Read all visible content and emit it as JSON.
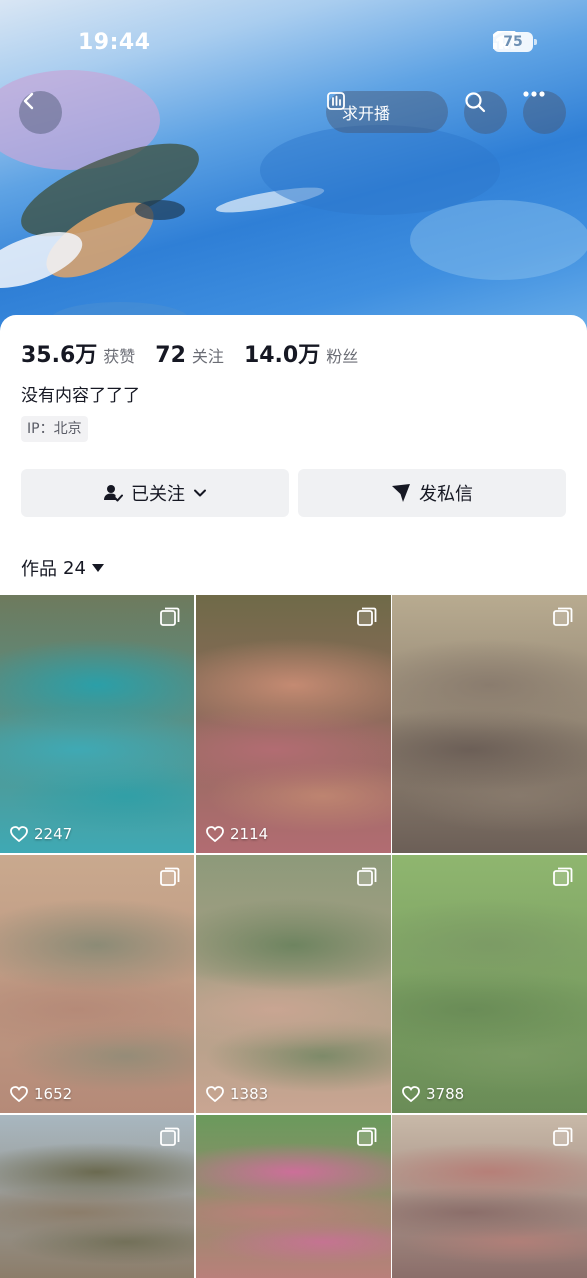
{
  "status_bar": {
    "time": "19:44",
    "battery": "75"
  },
  "header": {
    "back_icon": "chevron-left-icon",
    "live_request_label": "求开播",
    "search_icon": "search-icon",
    "more_icon": "more-icon"
  },
  "profile": {
    "stats": [
      {
        "value": "35.6万",
        "label": "获赞"
      },
      {
        "value": "72",
        "label": "关注"
      },
      {
        "value": "14.0万",
        "label": "粉丝"
      }
    ],
    "bio": "没有内容了了了",
    "ip": "IP：北京"
  },
  "actions": {
    "followed_label": "已关注",
    "message_label": "发私信"
  },
  "works": {
    "label": "作品",
    "count": "24"
  },
  "grid": [
    {
      "likes": "2247",
      "colors": [
        "#6e7a5d",
        "#2b9fa8",
        "#3fa9b4"
      ]
    },
    {
      "likes": "2114",
      "colors": [
        "#6f6a48",
        "#c48a72",
        "#b26c72"
      ]
    },
    {
      "likes": "",
      "colors": [
        "#b8ab90",
        "#8a7c6e",
        "#6c5f57"
      ]
    },
    {
      "likes": "1652",
      "colors": [
        "#c9a98e",
        "#8c8b76",
        "#b58a78"
      ]
    },
    {
      "likes": "1383",
      "colors": [
        "#8d9a7a",
        "#6e8460",
        "#c9a592"
      ]
    },
    {
      "likes": "3788",
      "colors": [
        "#8fb66f",
        "#7c9b65",
        "#6a8c57"
      ]
    },
    {
      "likes": "",
      "colors": [
        "#a8b7c0",
        "#6b6a50",
        "#8c7d6a"
      ]
    },
    {
      "likes": "",
      "colors": [
        "#6a9a5c",
        "#cc6f99",
        "#b9807a"
      ]
    },
    {
      "likes": "",
      "colors": [
        "#c8b9a8",
        "#b67f78",
        "#8b6e6a"
      ]
    }
  ]
}
